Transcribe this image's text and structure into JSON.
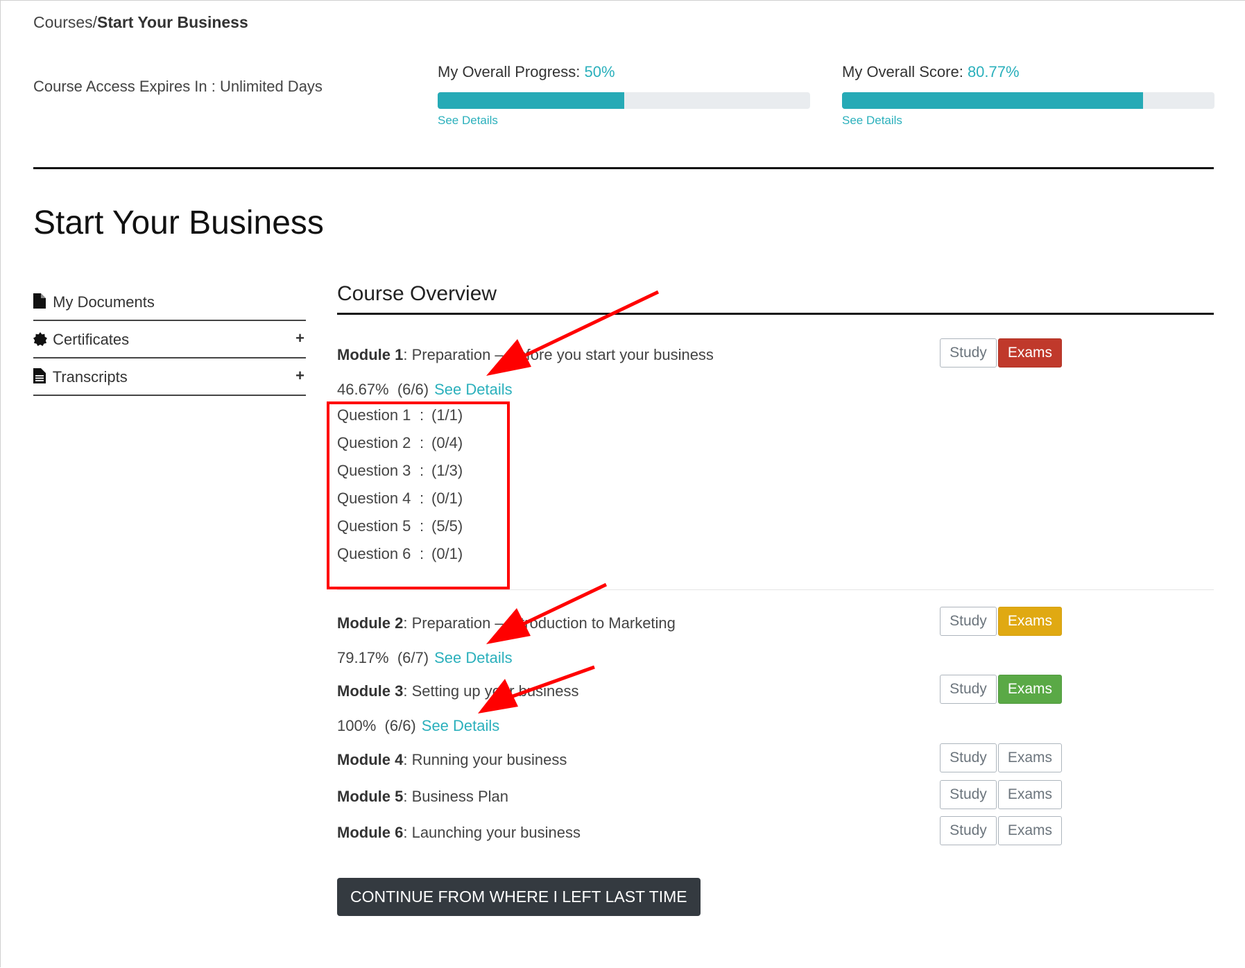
{
  "breadcrumb": {
    "parent": "Courses/",
    "current": "Start Your Business"
  },
  "header": {
    "expires_label": "Course Access Expires In : Unlimited Days",
    "progress": {
      "label": "My Overall Progress: ",
      "value_text": "50%",
      "fraction": 0.5,
      "link": "See Details"
    },
    "score": {
      "label": "My Overall Score: ",
      "value_text": "80.77%",
      "fraction": 0.8077,
      "link": "See Details"
    }
  },
  "title": "Start Your Business",
  "sidebar": {
    "items": [
      {
        "label": "My Documents",
        "icon": "file-icon",
        "expandable": false
      },
      {
        "label": "Certificates",
        "icon": "certificate-icon",
        "expandable": true,
        "toggle": "+"
      },
      {
        "label": "Transcripts",
        "icon": "file-text-icon",
        "expandable": true,
        "toggle": "+"
      }
    ]
  },
  "overview": {
    "title": "Course Overview",
    "study_label": "Study",
    "exams_label": "Exams",
    "see_details": "See Details",
    "modules": [
      {
        "num": "Module 1",
        "sep": ": ",
        "name": "Preparation – Before you start your business",
        "exams_state": "red",
        "score": "46.67%",
        "count": "(6/6)"
      },
      {
        "num": "Module 2",
        "sep": ": ",
        "name": "Preparation – Introduction to Marketing",
        "exams_state": "yellow",
        "score": "79.17%",
        "count": "(6/7)"
      },
      {
        "num": "Module 3",
        "sep": ": ",
        "name": "Setting up your business",
        "exams_state": "green",
        "score": "100%",
        "count": "(6/6)"
      },
      {
        "num": "Module 4",
        "sep": ": ",
        "name": "Running your business",
        "exams_state": "default"
      },
      {
        "num": "Module 5",
        "sep": ": ",
        "name": "Business Plan",
        "exams_state": "default"
      },
      {
        "num": "Module 6",
        "sep": ": ",
        "name": "Launching your business",
        "exams_state": "default"
      }
    ],
    "questions": [
      {
        "name": "Question 1",
        "sep": ":",
        "value": "(1/1)"
      },
      {
        "name": "Question 2",
        "sep": ":",
        "value": "(0/4)"
      },
      {
        "name": "Question 3",
        "sep": ":",
        "value": "(1/3)"
      },
      {
        "name": "Question 4",
        "sep": ":",
        "value": "(0/1)"
      },
      {
        "name": "Question 5",
        "sep": ":",
        "value": "(5/5)"
      },
      {
        "name": "Question 6",
        "sep": ":",
        "value": "(0/1)"
      }
    ],
    "continue_label": "CONTINUE FROM WHERE I LEFT LAST TIME"
  },
  "colors": {
    "accent": "#2bb0bc",
    "progress_fill": "#26aab6",
    "exams_red": "#c0392b",
    "exams_yellow": "#e0a912",
    "exams_green": "#5aa946",
    "annotation": "#ff0000",
    "continue_bg": "#343a40"
  }
}
